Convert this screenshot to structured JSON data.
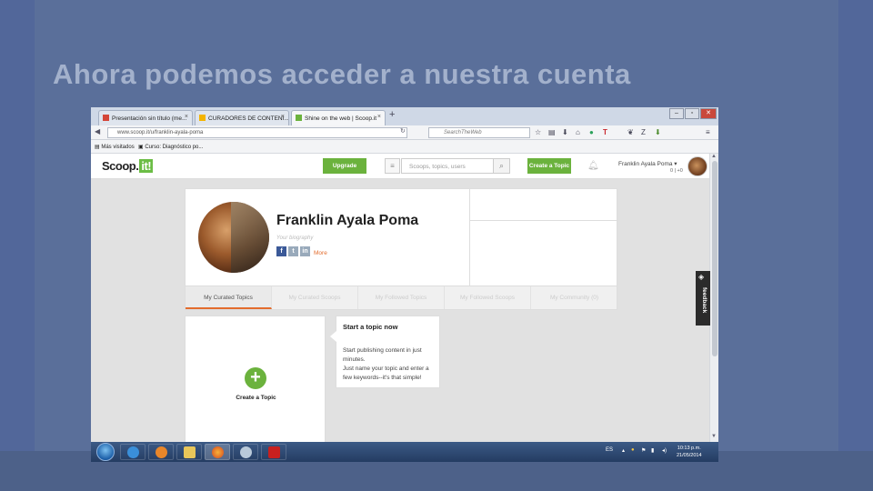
{
  "slide": {
    "title": "Ahora podemos acceder a nuestra cuenta"
  },
  "browser": {
    "tabs": [
      {
        "label": "Presentación sin título (me...",
        "icon": "gmail-icon"
      },
      {
        "label": "CURADORES DE CONTENI...",
        "icon": "docs-icon"
      },
      {
        "label": "Shine on the web | Scoop.it",
        "icon": "scoopit-icon"
      }
    ],
    "new_tab": "+",
    "url": "www.scoop.it/u/franklin-ayala-poma",
    "search_placeholder": "SearchTheWeb",
    "bookmarks": [
      {
        "label": "Más visitados"
      },
      {
        "label": "Curso: Diagnóstico po..."
      }
    ]
  },
  "site": {
    "logo_text": "Scoop.",
    "logo_badge": "it!",
    "upgrade_label": "Upgrade",
    "search_placeholder": "Scoops, topics, users",
    "create_topic_label": "Create a Topic",
    "user_name": "Franklin Ayala Poma",
    "user_counts": "0 | +0"
  },
  "profile": {
    "name": "Franklin Ayala Poma",
    "bio_placeholder": "Your biography",
    "more_label": "More",
    "tabs": [
      "My Curated Topics",
      "My Curated Scoops",
      "My Followed Topics",
      "My Followed Scoops",
      "My Community (0)"
    ]
  },
  "create_card": {
    "plus": "+",
    "label": "Create a Topic"
  },
  "tip": {
    "title": "Start a topic now",
    "line1": "Start publishing content in just minutes.",
    "line2": "Just name your topic and enter a few keywords--it's that simple!"
  },
  "feedback": {
    "label": "feedback"
  },
  "taskbar": {
    "lang": "ES",
    "time": "10:13 p.m.",
    "date": "21/05/2014"
  },
  "colors": {
    "slide_bg": "#5a6f9a",
    "accent_green": "#6bb23d",
    "accent_orange": "#e36c2d"
  }
}
